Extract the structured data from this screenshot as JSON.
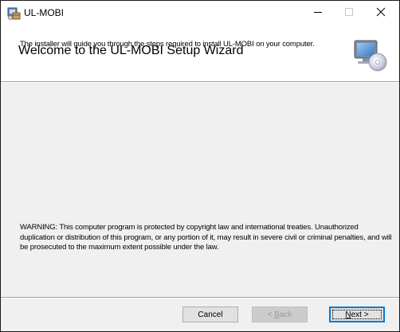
{
  "window": {
    "title": "UL-MOBI",
    "controls": {
      "minimize": "minimize-icon",
      "maximize": "maximize-icon",
      "close": "close-icon"
    }
  },
  "banner": {
    "title": "Welcome to the UL-MOBI Setup Wizard",
    "icon": "setup-computer-cd-icon"
  },
  "body": {
    "intro": "The installer will guide you through the steps required to install UL-MOBI on your computer.",
    "warning": "WARNING: This computer program is protected by copyright law and international treaties. Unauthorized duplication or distribution of this program, or any portion of it, may result in severe civil or criminal penalties, and will be prosecuted to the maximum extent possible under the law."
  },
  "buttons": {
    "cancel": "Cancel",
    "back_prefix": "< ",
    "back_key": "B",
    "back_rest": "ack",
    "next_key": "N",
    "next_rest": "ext >"
  },
  "colors": {
    "title_bar": "#ffffff",
    "dialog_bg": "#f0f0f0",
    "focus_border": "#0078d7",
    "disabled_text": "#9a9a9a"
  }
}
